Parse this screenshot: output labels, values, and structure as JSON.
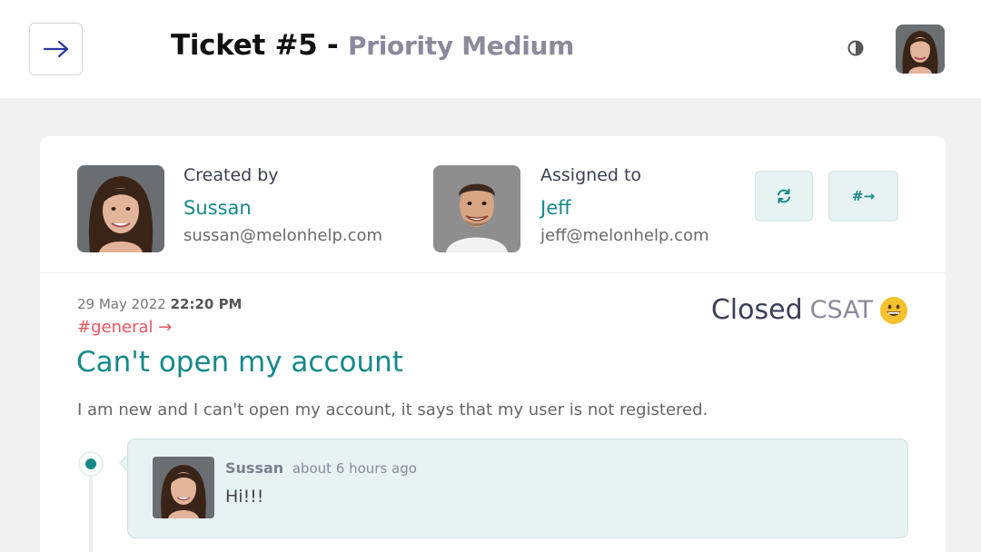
{
  "header": {
    "title": "Ticket #5 -",
    "priority": "Priority Medium"
  },
  "ticket": {
    "created_by": {
      "label": "Created by",
      "name": "Sussan",
      "email": "sussan@melonhelp.com"
    },
    "assigned_to": {
      "label": "Assigned to",
      "name": "Jeff",
      "email": "jeff@melonhelp.com"
    },
    "actions": {
      "refresh_icon": "refresh-icon",
      "move_label": "#→"
    },
    "date": "29 May 2022",
    "time": "22:20 PM",
    "channel": "#general →",
    "status": "Closed",
    "csat_label": "CSAT",
    "csat_emoji": "grinning-face",
    "title": "Can't open my account",
    "description": "I am new and I can't open my account, it says that my user is not registered."
  },
  "comments": [
    {
      "author": "Sussan",
      "time": "about 6 hours ago",
      "body": "Hi!!!"
    }
  ],
  "colors": {
    "accent": "#16898a",
    "channel": "#e8545f",
    "muted": "#8a8a9c"
  }
}
